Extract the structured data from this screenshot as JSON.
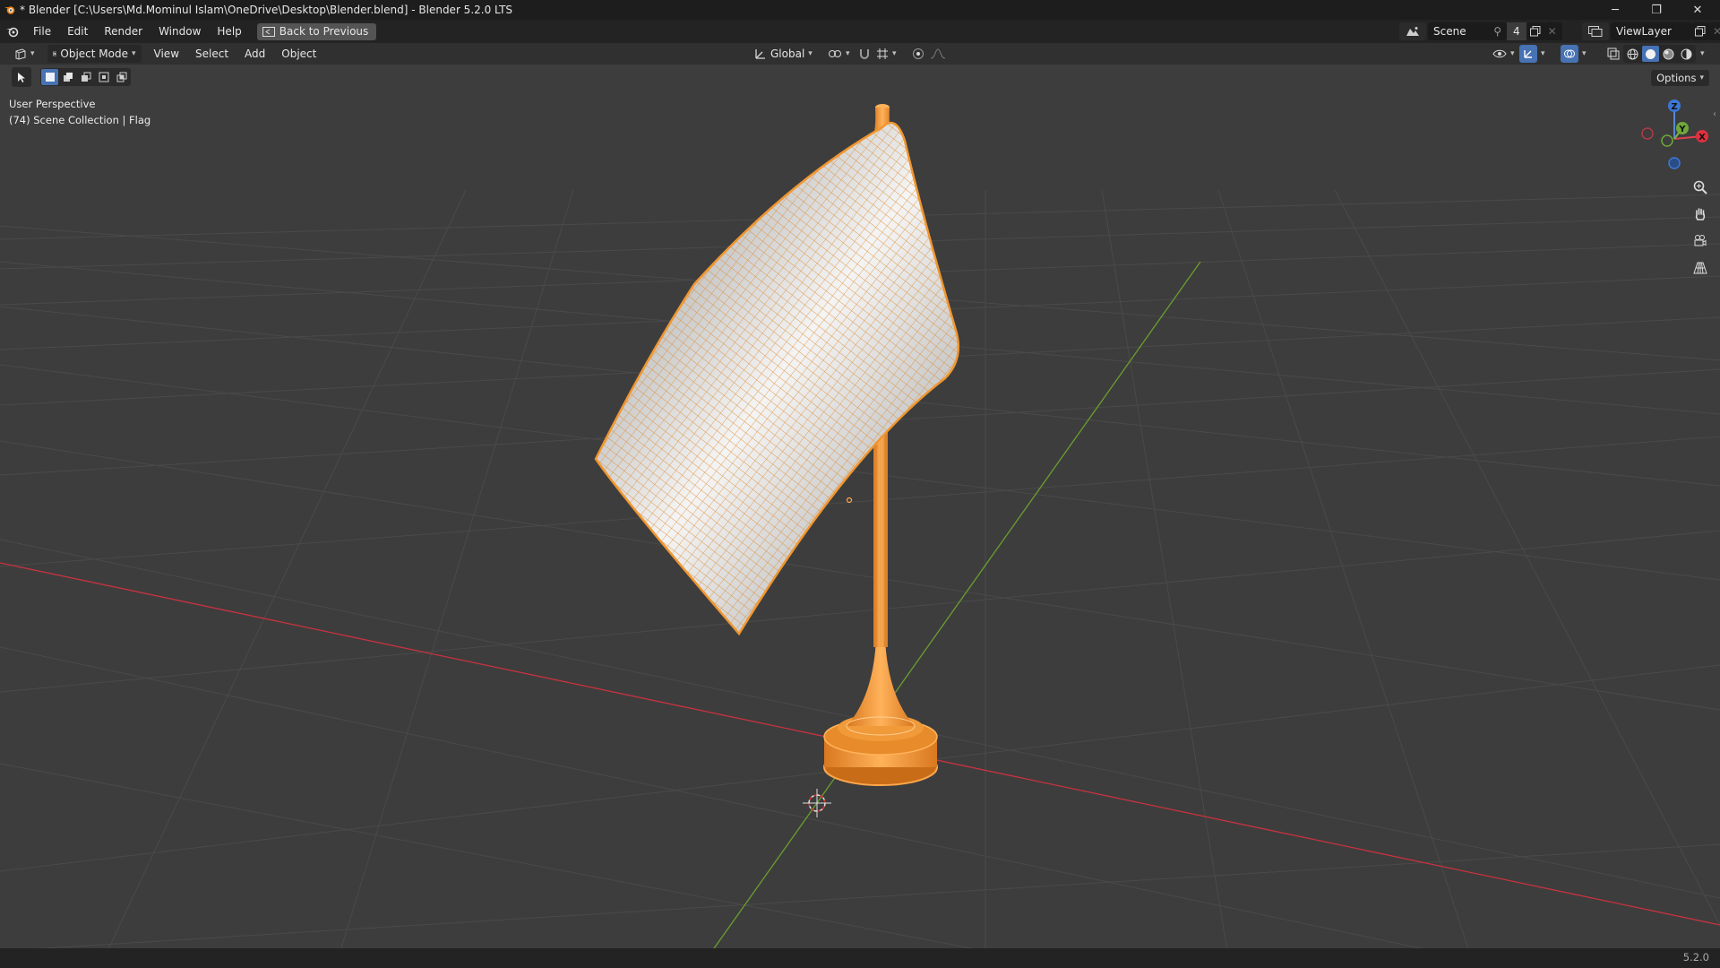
{
  "window": {
    "title": "* Blender [C:\\Users\\Md.Mominul Islam\\OneDrive\\Desktop\\Blender.blend] - Blender 5.2.0 LTS",
    "minimize": "─",
    "maximize": "❐",
    "close": "✕"
  },
  "menubar": {
    "items": [
      "File",
      "Edit",
      "Render",
      "Window",
      "Help"
    ],
    "back_button": "Back to Previous",
    "scene_name": "Scene",
    "scene_users": "4",
    "view_layer": "ViewLayer"
  },
  "header": {
    "mode": "Object Mode",
    "menus": [
      "View",
      "Select",
      "Add",
      "Object"
    ],
    "transform_orientation": "Global"
  },
  "viewport": {
    "perspective_label": "User Perspective",
    "collection_label": "(74) Scene Collection | Flag",
    "options_label": "Options",
    "gizmo": {
      "x": "X",
      "y": "Y",
      "z": "Z"
    },
    "selection_color": "#f0962f",
    "grid_x_color": "#c9323f",
    "grid_y_color": "#6b9e2f"
  },
  "statusbar": {
    "version": "5.2.0"
  }
}
